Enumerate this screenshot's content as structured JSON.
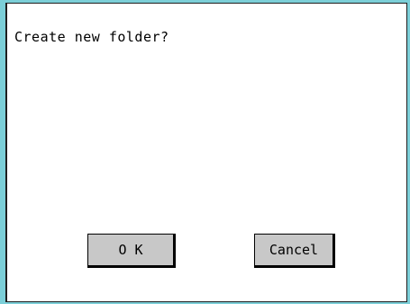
{
  "dialog": {
    "message": "Create new folder?",
    "ok_label": "O K",
    "cancel_label": "Cancel"
  },
  "colors": {
    "frame": "#7ccfd8",
    "button_face": "#c8c8c8",
    "text": "#000000"
  }
}
